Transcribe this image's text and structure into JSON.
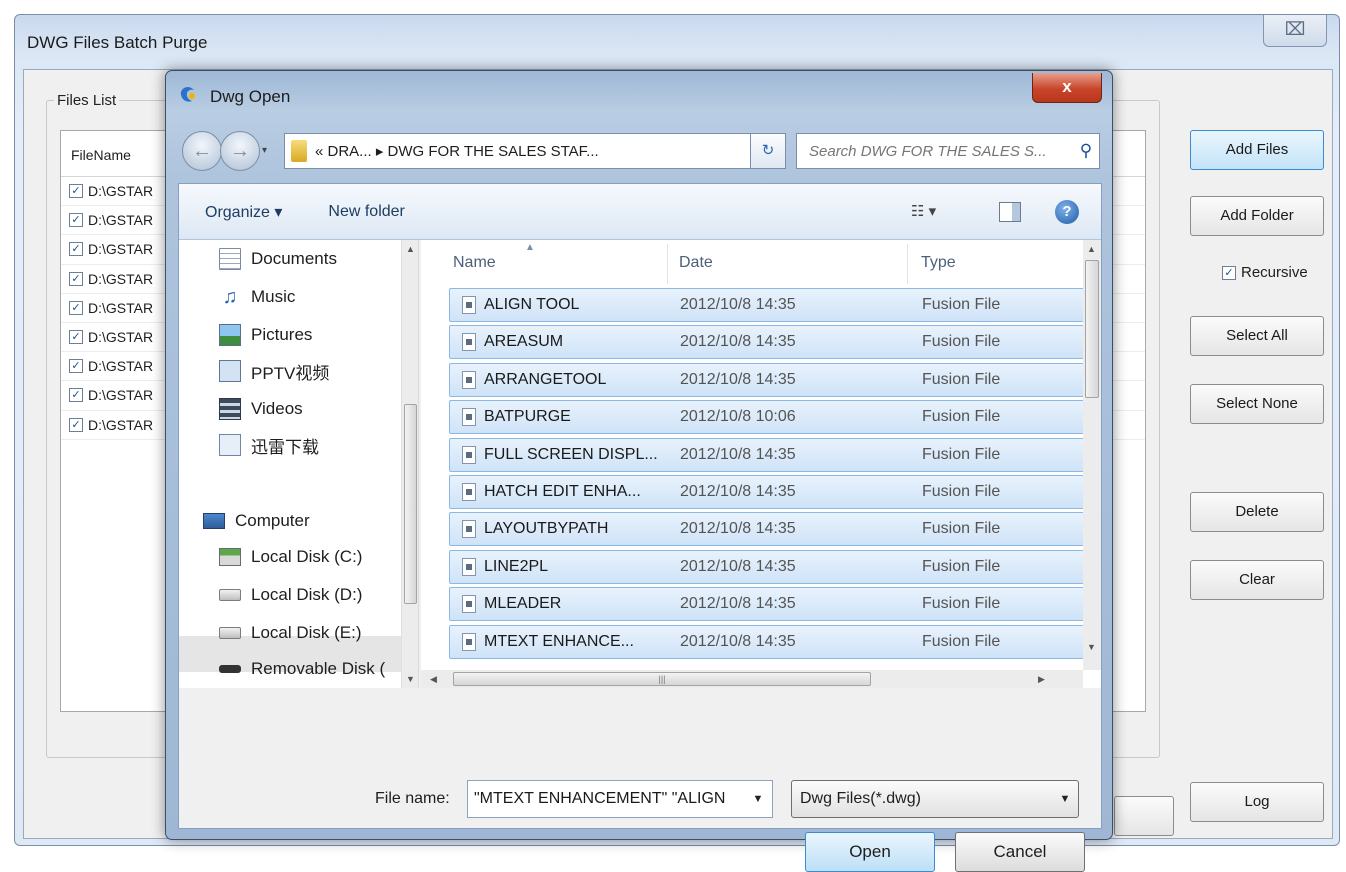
{
  "main_window": {
    "title": "DWG Files Batch Purge",
    "close_symbol": "⌧",
    "files_list_label": "Files List",
    "column_header": "FileName",
    "file_rows": [
      "D:\\GSTAR",
      "D:\\GSTAR",
      "D:\\GSTAR",
      "D:\\GSTAR",
      "D:\\GSTAR",
      "D:\\GSTAR",
      "D:\\GSTAR",
      "D:\\GSTAR",
      "D:\\GSTAR"
    ],
    "buttons": {
      "add_files": "Add Files",
      "add_folder": "Add Folder",
      "select_all": "Select All",
      "select_none": "Select None",
      "delete": "Delete",
      "clear": "Clear",
      "log": "Log"
    },
    "recursive_label": "Recursive",
    "check_mark": "✓"
  },
  "dialog": {
    "title": "Dwg Open",
    "close_symbol": "x",
    "back_symbol": "←",
    "forward_symbol": "→",
    "address_path": "«  DRA... ▸ DWG FOR THE SALES STAF...",
    "search_placeholder": "Search DWG FOR THE SALES S...",
    "toolbar": {
      "organize": "Organize ▾",
      "new_folder": "New folder",
      "view_symbol": "☷ ▾",
      "help_symbol": "?"
    },
    "nav_items": [
      "Documents",
      "Music",
      "Pictures",
      "PPTV视频",
      "Videos",
      "迅雷下载",
      "Computer",
      "Local Disk (C:)",
      "Local Disk (D:)",
      "Local Disk (E:)",
      "Removable Disk ("
    ],
    "columns": {
      "name": "Name",
      "date": "Date",
      "type": "Type"
    },
    "files": [
      {
        "name": "ALIGN TOOL",
        "date": "2012/10/8 14:35",
        "type": "Fusion File"
      },
      {
        "name": "AREASUM",
        "date": "2012/10/8 14:35",
        "type": "Fusion File"
      },
      {
        "name": "ARRANGETOOL",
        "date": "2012/10/8 14:35",
        "type": "Fusion File"
      },
      {
        "name": "BATPURGE",
        "date": "2012/10/8 10:06",
        "type": "Fusion File"
      },
      {
        "name": "FULL SCREEN DISPL...",
        "date": "2012/10/8 14:35",
        "type": "Fusion File"
      },
      {
        "name": "HATCH EDIT ENHA...",
        "date": "2012/10/8 14:35",
        "type": "Fusion File"
      },
      {
        "name": "LAYOUTBYPATH",
        "date": "2012/10/8 14:35",
        "type": "Fusion File"
      },
      {
        "name": "LINE2PL",
        "date": "2012/10/8 14:35",
        "type": "Fusion File"
      },
      {
        "name": "MLEADER",
        "date": "2012/10/8 14:35",
        "type": "Fusion File"
      },
      {
        "name": "MTEXT ENHANCE...",
        "date": "2012/10/8 14:35",
        "type": "Fusion File"
      }
    ],
    "file_name_label": "File name:",
    "file_name_value": "\"MTEXT ENHANCEMENT\" \"ALIGN",
    "file_type": "Dwg Files(*.dwg)",
    "open_button": "Open",
    "cancel_button": "Cancel"
  }
}
